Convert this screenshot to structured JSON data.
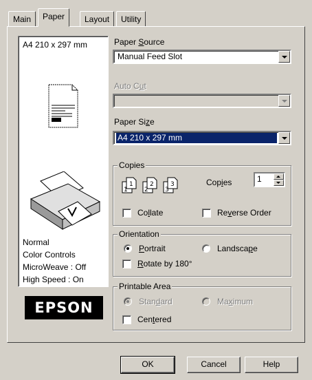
{
  "tabs": [
    "Main",
    "Paper",
    "Layout",
    "Utility"
  ],
  "active_tab": "Paper",
  "preview": {
    "paper_label": "A4 210 x 297 mm",
    "settings": [
      "Normal",
      "Color Controls",
      "MicroWeave : Off",
      "High Speed : On"
    ],
    "logo": "EPSON"
  },
  "paper_source": {
    "label_pre": "Paper ",
    "label_key": "S",
    "label_post": "ource",
    "value": "Manual Feed Slot"
  },
  "auto_cut": {
    "label_pre": "Auto C",
    "label_key": "u",
    "label_post": "t",
    "value": ""
  },
  "paper_size": {
    "label_pre": "Paper Si",
    "label_key": "z",
    "label_post": "e",
    "value": "A4 210 x 297 mm"
  },
  "copies": {
    "group_title": "Copies",
    "label_pre": "Cop",
    "label_key": "i",
    "label_post": "es",
    "value": "1",
    "collate": {
      "pre": "Co",
      "key": "l",
      "post": "late",
      "checked": false
    },
    "reverse": {
      "pre": "Re",
      "key": "v",
      "post": "erse Order",
      "checked": false
    }
  },
  "orientation": {
    "group_title": "Orientation",
    "portrait": {
      "pre": "",
      "key": "P",
      "post": "ortrait",
      "selected": true
    },
    "landscape": {
      "pre": "Landsca",
      "key": "p",
      "post": "e",
      "selected": false
    },
    "rotate": {
      "pre": "",
      "key": "R",
      "post": "otate by 180°",
      "checked": false
    }
  },
  "printable_area": {
    "group_title": "Printable Area",
    "standard": {
      "pre": "Stan",
      "key": "d",
      "post": "ard",
      "selected": true
    },
    "maximum": {
      "pre": "Ma",
      "key": "x",
      "post": "imum",
      "selected": false
    },
    "centered": {
      "pre": "Cen",
      "key": "t",
      "post": "ered",
      "checked": false
    }
  },
  "buttons": {
    "ok": "OK",
    "cancel": "Cancel",
    "help": "Help"
  }
}
